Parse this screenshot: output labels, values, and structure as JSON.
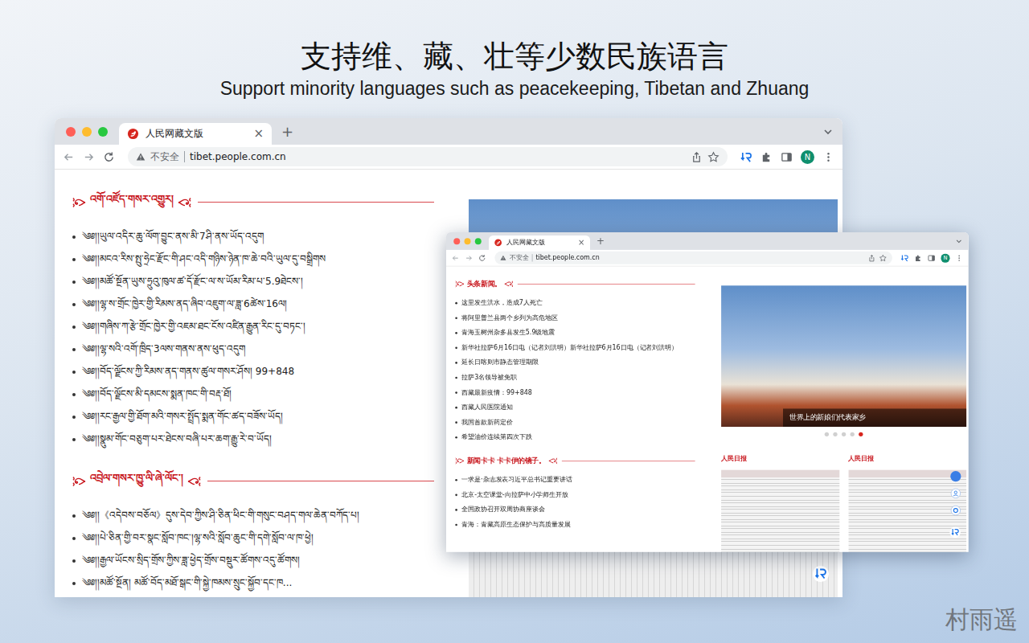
{
  "hero": {
    "title": "支持维、藏、壮等少数民族语言",
    "subtitle": "Support minority languages such as peacekeeping, Tibetan and Zhuang"
  },
  "windows": [
    {
      "kind": "tibetan",
      "tab": {
        "label": "人民网藏文版",
        "close": "×",
        "selected": true
      },
      "new_tab": "+",
      "address": {
        "security": "不安全",
        "url": "tibet.people.com.cn"
      },
      "profile": "N",
      "sections": [
        {
          "heading": "འགོ་འཛོད་གསར་འགྱུར།",
          "items": [
            "༄༅།།ཡུལ་འདིར་ཆུ་ལོག་བྱུང་ནས་མི་7ཤི་ནས་ཡོད་འདུག",
            "༄༅།།མངའ་རིས་སྤུ་ཧྲེང་རྫོང་གི་ཤང་འདི་གཉིས་ཉེན་ཁ་ཆེ་བའི་ཡུལ་དུ་བསྒྲིགས",
            "༄༅།།མཚོ་སྔོན་ཡུས་ཧྲུའུ་ཁུལ་ཚ་དོ་རྫོང་ལ་ས་ཡོམ་རིམ་པ་5.9ཐེངས་།",
            "༄༅།།ལྷ་ས་གྲོང་ཁྱེར་གྱི་རིམས་ནད་ཞིབ་འཇུག་ལ་ཟླ་6ཚེས་16ལ།",
            "༄༅།།གཞིས་ཀ་རྩེ་གྲོང་ཁྱེར་གྱི་འཇམ་ཐང་ངོས་འཛིན་རྒྱུན་རིང་དུ་བཏང་།",
            "༄༅།།ལྷ་སའི་འགོ་ཁྲིད་3ལས་གནས་ནས་ཕུད་འདུག",
            "༄༅།།བོད་ལྗོངས་ཀྱི་རིམས་ནད་གནས་ཚུལ་གསར་ཤོས། 99+848",
            "༄༅།།བོད་ལྗོངས་མི་དམངས་སྨན་ཁང་གི་བརྡ་ཐོ།",
            "༄༅།།རང་རྒྱལ་གྱི་ཐོག་མའི་གསར་སྤྲོད་སྨན་གོང་ཚད་བཟོས་ཡོད།",
            "༄༅།།སྣུམ་གོང་བཅུག་པར་ཐེངས་བཞི་པར་ཆག་རྒྱུ་རེ་བ་ཡོད།"
          ]
        },
        {
          "heading": "འབྲེལ་གསར་ཁྱུ་ལི་ཞེ་ལོང་།",
          "items": [
            "༄༅།།《འདེབས་བཅོལ》དུས་དེབ་ཀྱིས་ཤི་ཅིན་ཕིང་གི་གསུང་བཤད་གལ་ཆེན་བཀོད་པ།",
            "༄༅།།པེ་ཅིན་གྱི་བར་སྣང་སློབ་ཁང་།ལྷ་སའི་སློབ་ཆུང་གི་དགེ་སློབ་ལ་ཁ་ཕྱེ།",
            "༄༅།།རྒྱལ་ཡོངས་སྲིད་གྲོས་ཀྱིས་ཟླ་ཕྱེད་གྲོས་བསྡུར་ཚོགས་འདུ་ཚོགས།",
            "༄༅།།མཚོ་སྔོན། མཚོ་བོད་མཐོ་སྒང་གི་སྐྱེ་ཁམས་སྲུང་སྐྱོབ་དང་ཁ..."
          ]
        }
      ]
    },
    {
      "kind": "chinese",
      "tab": {
        "label": "人民网藏文版",
        "close": "×",
        "selected": true
      },
      "new_tab": "+",
      "address": {
        "security": "不安全",
        "url": "tibet.people.com.cn"
      },
      "profile": "N",
      "sections": [
        {
          "heading": "头条新闻。",
          "items": [
            "这里发生洪水，造成7人死亡",
            "将阿里普兰县两个乡列为高危地区",
            "青海玉树州杂多县发生5.9级地震",
            "新华社拉萨6月16日电（记者刘洪明）新华社拉萨6月16日电（记者刘洪明）",
            "延长日喀则市静态管理期限",
            "拉萨3名领导被免职",
            "西藏最新疫情：99+848",
            "西藏人民医院通知",
            "我国首款新药定价",
            "希望油价连续第四次下跌"
          ]
        },
        {
          "heading": "新闻卡卡 卡卡伊的镜子。",
          "items": [
            "一求是·杂志发表习近平总书记重要讲话",
            "北京-太空课堂-向拉萨中小学师生开放",
            "全国政协召开双周协商座谈会",
            "青海：青藏高原生态保护与高质量发展"
          ]
        }
      ],
      "carousel": {
        "caption": "世界上的新娘们代表家乡",
        "dots": [
          {
            "selected": false
          },
          {
            "selected": false
          },
          {
            "selected": false
          },
          {
            "selected": false
          },
          {
            "selected": true
          }
        ]
      },
      "papers": [
        {
          "title": "人民日报"
        },
        {
          "title": "人民日报"
        }
      ]
    }
  ],
  "watermark": "村雨遥"
}
